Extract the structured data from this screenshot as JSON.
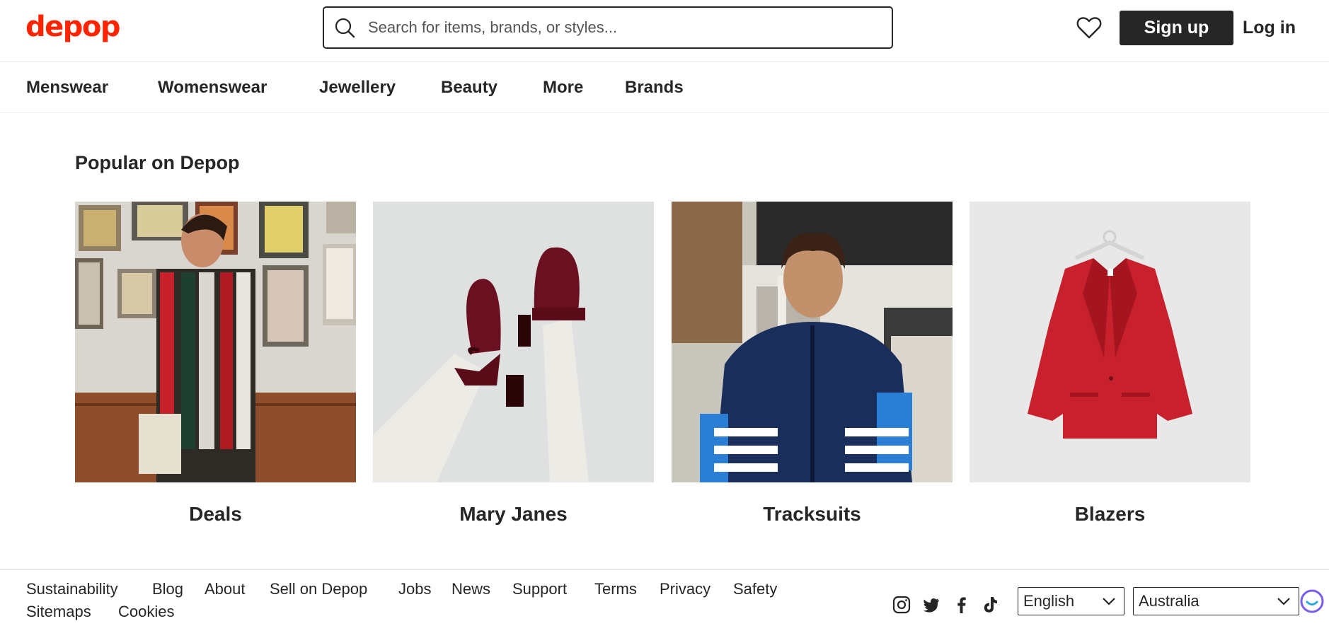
{
  "header": {
    "logo": "depop",
    "search_placeholder": "Search for items, brands, or styles...",
    "signup_label": "Sign up",
    "login_label": "Log in"
  },
  "nav": {
    "items": [
      {
        "label": "Menswear"
      },
      {
        "label": "Womenswear"
      },
      {
        "label": "Jewellery"
      },
      {
        "label": "Beauty"
      },
      {
        "label": "More"
      },
      {
        "label": "Brands"
      }
    ]
  },
  "popular": {
    "title": "Popular on Depop",
    "tiles": [
      {
        "label": "Deals"
      },
      {
        "label": "Mary Janes"
      },
      {
        "label": "Tracksuits"
      },
      {
        "label": "Blazers"
      }
    ]
  },
  "footer": {
    "links": [
      {
        "label": "Sustainability"
      },
      {
        "label": "Blog"
      },
      {
        "label": "About"
      },
      {
        "label": "Sell on Depop"
      },
      {
        "label": "Jobs"
      },
      {
        "label": "News"
      },
      {
        "label": "Support"
      },
      {
        "label": "Terms"
      },
      {
        "label": "Privacy"
      },
      {
        "label": "Safety"
      },
      {
        "label": "Sitemaps"
      },
      {
        "label": "Cookies"
      }
    ],
    "social_icons": [
      "instagram-icon",
      "twitter-icon",
      "facebook-icon",
      "tiktok-icon"
    ],
    "language": "English",
    "country": "Australia"
  },
  "colors": {
    "brand": "#ff2300",
    "text": "#262626",
    "button_bg": "#262626"
  }
}
